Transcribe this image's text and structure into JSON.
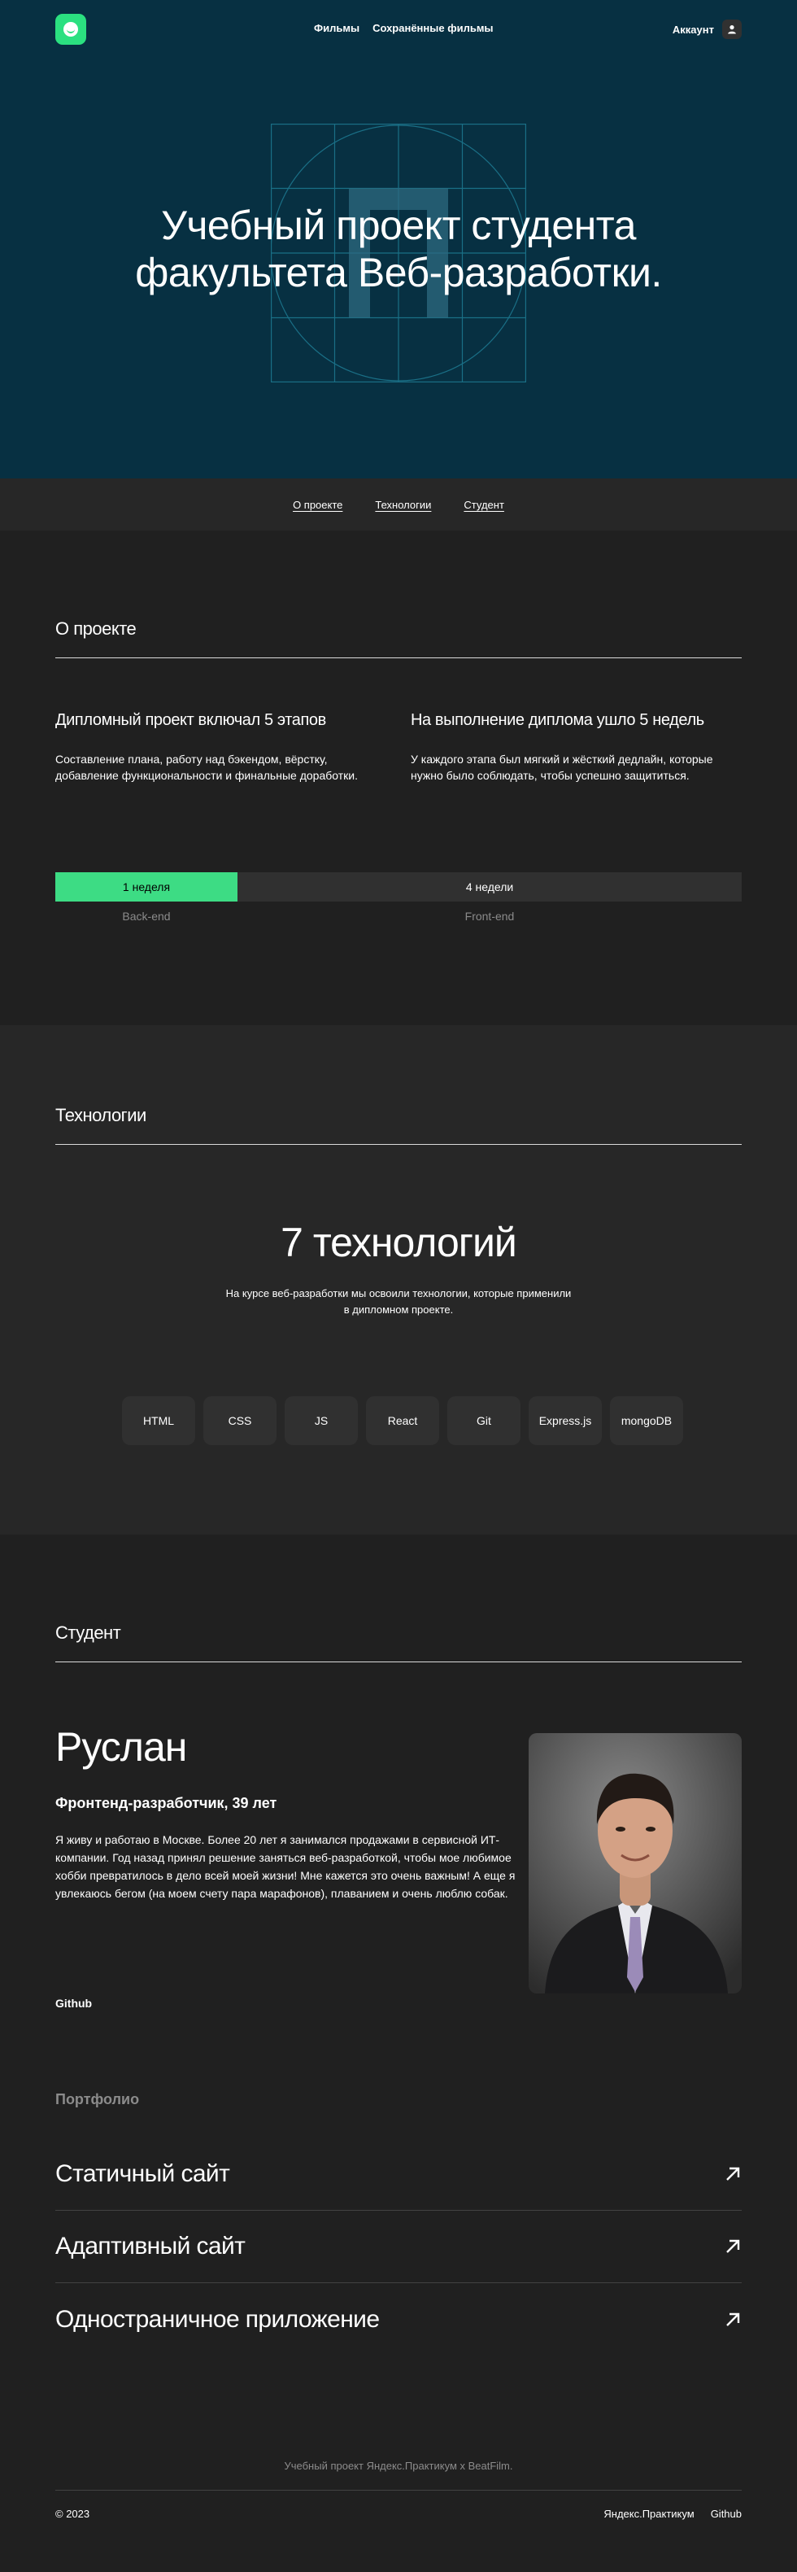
{
  "header": {
    "logo_icon": "smile-logo-icon",
    "nav": [
      "Фильмы",
      "Сохранённые фильмы"
    ],
    "account_label": "Аккаунт",
    "account_icon": "user-icon"
  },
  "hero": {
    "title_line1": "Учебный проект студента",
    "title_line2": "факультета Веб-разработки."
  },
  "anchors": [
    "О проекте",
    "Технологии",
    "Студент"
  ],
  "about": {
    "title": "О проекте",
    "col1_title": "Дипломный проект включал 5 этапов",
    "col1_text": "Составление плана, работу над бэкендом, вёрстку, добавление функциональности и финальные доработки.",
    "col2_title": "На выполнение диплома ушло 5 недель",
    "col2_text": "У каждого этапа был мягкий и жёсткий дедлайн, которые нужно было соблюдать, чтобы успешно защититься.",
    "backend_weeks": "1 неделя",
    "frontend_weeks": "4 недели",
    "backend_label": "Back-end",
    "frontend_label": "Front-end"
  },
  "techs": {
    "title": "Технологии",
    "count": "7 технологий",
    "desc_line1": "На курсе веб-разработки мы освоили технологии, которые применили",
    "desc_line2": "в дипломном проекте.",
    "items": [
      "HTML",
      "CSS",
      "JS",
      "React",
      "Git",
      "Express.js",
      "mongoDB"
    ]
  },
  "student": {
    "title": "Студент",
    "name": "Руслан",
    "role": "Фронтенд-разработчик, 39 лет",
    "bio": "Я живу и работаю в Москве. Более 20 лет я занимался продажами в сервисной ИТ-компании. Год назад принял решение заняться веб-разработкой, чтобы мое любимое хобби превратилось в дело всей моей жизни! Мне кажется это очень важным! А еще я увлекаюсь бегом (на моем счету пара марафонов), плаванием и очень люблю собак.",
    "github": "Github",
    "portfolio_title": "Портфолио",
    "portfolio": [
      "Статичный сайт",
      "Адаптивный сайт",
      "Одностраничное приложение"
    ]
  },
  "footer": {
    "note": "Учебный проект Яндекс.Практикум х BeatFilm.",
    "copyright": "© 2023",
    "links": [
      "Яндекс.Практикум",
      "Github"
    ]
  },
  "colors": {
    "hero_bg": "#073042",
    "accent": "#3DDC84",
    "page_bg": "#202020",
    "section_bg": "#272727"
  }
}
